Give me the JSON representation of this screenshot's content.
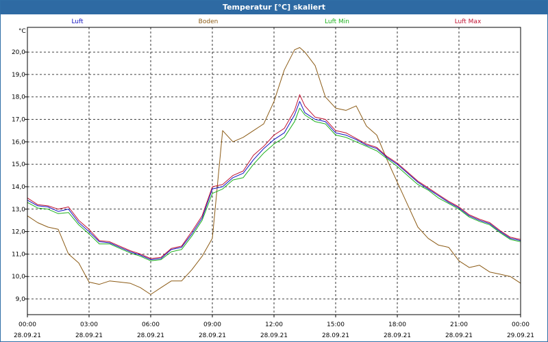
{
  "window": {
    "title": "Temperatur [°C] skaliert"
  },
  "chart_data": {
    "type": "line",
    "title": "Temperatur [°C] skaliert",
    "ylabel": "°C",
    "ylim": [
      8.3,
      21.1
    ],
    "yticks": [
      9.0,
      10.0,
      11.0,
      12.0,
      13.0,
      14.0,
      15.0,
      16.0,
      17.0,
      18.0,
      19.0,
      20.0
    ],
    "ytick_labels": [
      "9,0",
      "10,0",
      "11,0",
      "12,0",
      "13,0",
      "14,0",
      "15,0",
      "16,0",
      "17,0",
      "18,0",
      "19,0",
      "20,0"
    ],
    "xlim": [
      0,
      24
    ],
    "xticks": [
      0,
      3,
      6,
      9,
      12,
      15,
      18,
      21,
      24
    ],
    "xtick_time_labels": [
      "00:00",
      "03:00",
      "06:00",
      "09:00",
      "12:00",
      "15:00",
      "18:00",
      "21:00",
      "00:00"
    ],
    "xtick_date_labels": [
      "28.09.21",
      "28.09.21",
      "28.09.21",
      "28.09.21",
      "28.09.21",
      "28.09.21",
      "28.09.21",
      "28.09.21",
      "29.09.21"
    ],
    "grid": true,
    "legend_position": "top",
    "series": [
      {
        "name": "Luft",
        "color": "#1010c0",
        "x": [
          0,
          0.5,
          1,
          1.5,
          2,
          2.5,
          3,
          3.5,
          4,
          4.5,
          5,
          5.5,
          6,
          6.5,
          7,
          7.5,
          8,
          8.5,
          9,
          9.5,
          10,
          10.5,
          11,
          11.5,
          12,
          12.5,
          13,
          13.25,
          13.5,
          14,
          14.5,
          15,
          15.5,
          16,
          16.5,
          17,
          17.5,
          18,
          18.5,
          19,
          19.5,
          20,
          20.5,
          21,
          21.5,
          22,
          22.5,
          23,
          23.5,
          24
        ],
        "values": [
          13.4,
          13.15,
          13.1,
          12.9,
          13.0,
          12.4,
          12.0,
          11.55,
          11.5,
          11.3,
          11.1,
          10.95,
          10.75,
          10.8,
          11.2,
          11.3,
          11.9,
          12.6,
          13.9,
          14.0,
          14.4,
          14.6,
          15.2,
          15.7,
          16.1,
          16.4,
          17.2,
          17.8,
          17.3,
          17.0,
          16.9,
          16.4,
          16.3,
          16.1,
          15.85,
          15.7,
          15.3,
          15.0,
          14.6,
          14.2,
          13.9,
          13.6,
          13.3,
          13.05,
          12.7,
          12.5,
          12.35,
          12.0,
          11.7,
          11.6
        ]
      },
      {
        "name": "Boden",
        "color": "#8b5a14",
        "x": [
          0,
          0.5,
          1,
          1.5,
          2,
          2.5,
          3,
          3.5,
          4,
          4.5,
          5,
          5.5,
          6,
          6.5,
          7,
          7.5,
          8,
          8.5,
          9,
          9.5,
          10,
          10.5,
          11,
          11.5,
          12,
          12.5,
          13,
          13.25,
          13.5,
          14,
          14.5,
          15,
          15.5,
          16,
          16.5,
          17,
          17.5,
          18,
          18.5,
          19,
          19.5,
          20,
          20.5,
          21,
          21.5,
          22,
          22.5,
          23,
          23.5,
          24
        ],
        "values": [
          12.7,
          12.4,
          12.2,
          12.1,
          11.0,
          10.6,
          9.75,
          9.65,
          9.8,
          9.75,
          9.7,
          9.5,
          9.2,
          9.5,
          9.8,
          9.8,
          10.3,
          10.9,
          11.7,
          16.5,
          16.0,
          16.2,
          16.5,
          16.8,
          17.8,
          19.2,
          20.1,
          20.2,
          20.0,
          19.4,
          18.0,
          17.5,
          17.4,
          17.6,
          16.7,
          16.3,
          15.2,
          14.2,
          13.2,
          12.2,
          11.7,
          11.4,
          11.3,
          10.7,
          10.4,
          10.5,
          10.2,
          10.1,
          10.0,
          9.7
        ]
      },
      {
        "name": "Luft Min",
        "color": "#1cb01c",
        "x": [
          0,
          0.5,
          1,
          1.5,
          2,
          2.5,
          3,
          3.5,
          4,
          4.5,
          5,
          5.5,
          6,
          6.5,
          7,
          7.5,
          8,
          8.5,
          9,
          9.5,
          10,
          10.5,
          11,
          11.5,
          12,
          12.5,
          13,
          13.25,
          13.5,
          14,
          14.5,
          15,
          15.5,
          16,
          16.5,
          17,
          17.5,
          18,
          18.5,
          19,
          19.5,
          20,
          20.5,
          21,
          21.5,
          22,
          22.5,
          23,
          23.5,
          24
        ],
        "values": [
          13.3,
          13.05,
          13.0,
          12.8,
          12.85,
          12.3,
          11.9,
          11.45,
          11.45,
          11.25,
          11.05,
          10.9,
          10.7,
          10.75,
          11.1,
          11.2,
          11.8,
          12.5,
          13.7,
          13.9,
          14.3,
          14.4,
          15.0,
          15.5,
          15.9,
          16.2,
          16.9,
          17.5,
          17.2,
          16.9,
          16.8,
          16.3,
          16.2,
          16.0,
          15.8,
          15.6,
          15.25,
          14.9,
          14.5,
          14.1,
          13.85,
          13.5,
          13.25,
          13.0,
          12.65,
          12.45,
          12.3,
          11.95,
          11.65,
          11.55
        ]
      },
      {
        "name": "Luft Max",
        "color": "#c01030",
        "x": [
          0,
          0.5,
          1,
          1.5,
          2,
          2.5,
          3,
          3.5,
          4,
          4.5,
          5,
          5.5,
          6,
          6.5,
          7,
          7.5,
          8,
          8.5,
          9,
          9.5,
          10,
          10.5,
          11,
          11.5,
          12,
          12.5,
          13,
          13.25,
          13.5,
          14,
          14.5,
          15,
          15.5,
          16,
          16.5,
          17,
          17.5,
          18,
          18.5,
          19,
          19.5,
          20,
          20.5,
          21,
          21.5,
          22,
          22.5,
          23,
          23.5,
          24
        ],
        "values": [
          13.5,
          13.2,
          13.15,
          13.0,
          13.1,
          12.5,
          12.1,
          11.6,
          11.55,
          11.35,
          11.15,
          11.0,
          10.8,
          10.85,
          11.25,
          11.35,
          12.0,
          12.7,
          14.0,
          14.1,
          14.5,
          14.7,
          15.4,
          15.8,
          16.3,
          16.6,
          17.4,
          18.1,
          17.6,
          17.1,
          17.0,
          16.5,
          16.4,
          16.15,
          15.9,
          15.75,
          15.35,
          15.05,
          14.65,
          14.25,
          13.95,
          13.65,
          13.35,
          13.1,
          12.75,
          12.55,
          12.4,
          12.05,
          11.75,
          11.65
        ]
      }
    ]
  }
}
